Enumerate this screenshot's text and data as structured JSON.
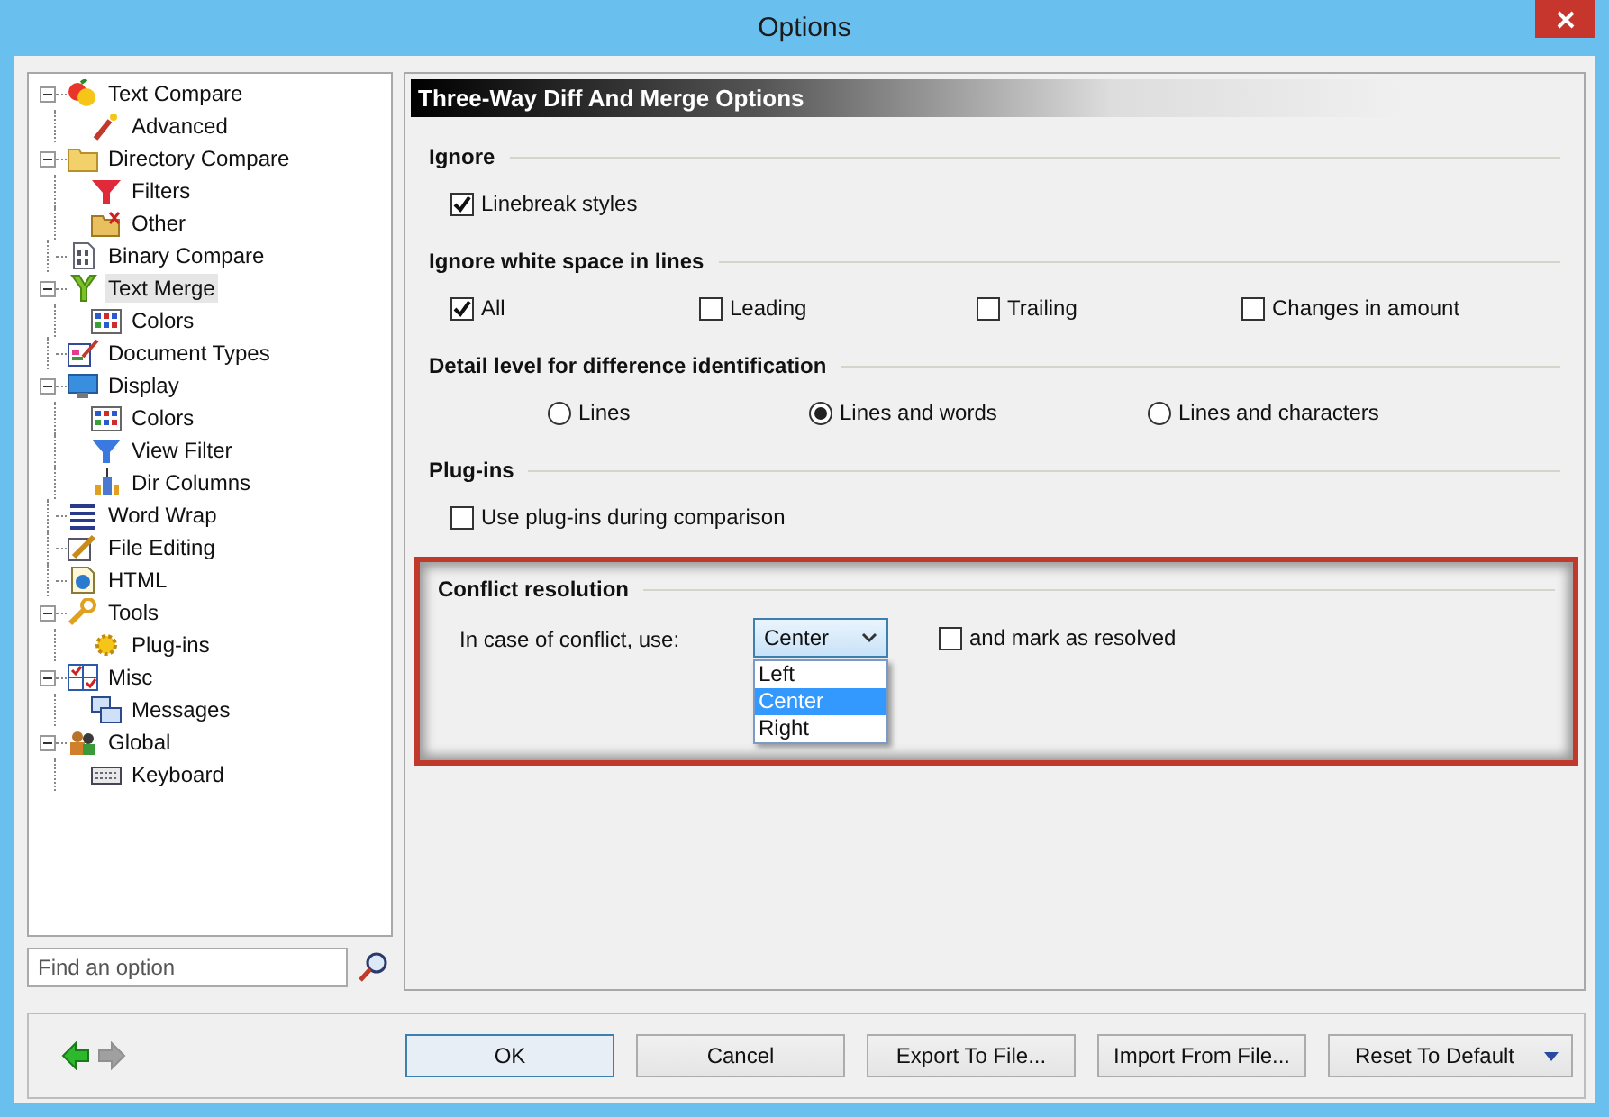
{
  "window": {
    "title": "Options"
  },
  "tree": [
    {
      "label": "Text Compare",
      "expanded": true,
      "selected": false,
      "children": [
        {
          "label": "Advanced",
          "selected": false
        }
      ]
    },
    {
      "label": "Directory Compare",
      "expanded": true,
      "selected": false,
      "children": [
        {
          "label": "Filters",
          "selected": false
        },
        {
          "label": "Other",
          "selected": false
        }
      ]
    },
    {
      "label": "Binary Compare",
      "selected": false
    },
    {
      "label": "Text Merge",
      "expanded": true,
      "selected": true,
      "children": [
        {
          "label": "Colors",
          "selected": false
        }
      ]
    },
    {
      "label": "Document Types",
      "selected": false
    },
    {
      "label": "Display",
      "expanded": true,
      "selected": false,
      "children": [
        {
          "label": "Colors",
          "selected": false
        },
        {
          "label": "View Filter",
          "selected": false
        },
        {
          "label": "Dir Columns",
          "selected": false
        }
      ]
    },
    {
      "label": "Word Wrap",
      "selected": false
    },
    {
      "label": "File Editing",
      "selected": false
    },
    {
      "label": "HTML",
      "selected": false
    },
    {
      "label": "Tools",
      "expanded": true,
      "selected": false,
      "children": [
        {
          "label": "Plug-ins",
          "selected": false
        }
      ]
    },
    {
      "label": "Misc",
      "expanded": true,
      "selected": false,
      "children": [
        {
          "label": "Messages",
          "selected": false
        }
      ]
    },
    {
      "label": "Global",
      "expanded": true,
      "selected": false,
      "children": [
        {
          "label": "Keyboard",
          "selected": false
        }
      ]
    }
  ],
  "search": {
    "placeholder": "Find an option"
  },
  "panel": {
    "title": "Three-Way Diff And Merge Options",
    "groups": [
      {
        "title": "Ignore",
        "options": [
          {
            "kind": "checkbox",
            "label": "Linebreak styles",
            "checked": true
          }
        ]
      },
      {
        "title": "Ignore white space in lines",
        "options": [
          {
            "kind": "checkbox",
            "label": "All",
            "checked": true
          },
          {
            "kind": "checkbox",
            "label": "Leading",
            "checked": false
          },
          {
            "kind": "checkbox",
            "label": "Trailing",
            "checked": false
          },
          {
            "kind": "checkbox",
            "label": "Changes in amount",
            "checked": false
          }
        ]
      },
      {
        "title": "Detail level for difference identification",
        "options": [
          {
            "kind": "radio",
            "label": "Lines",
            "selected": false
          },
          {
            "kind": "radio",
            "label": "Lines and words",
            "selected": true
          },
          {
            "kind": "radio",
            "label": "Lines and characters",
            "selected": false
          }
        ]
      },
      {
        "title": "Plug-ins",
        "options": [
          {
            "kind": "checkbox",
            "label": "Use plug-ins during comparison",
            "checked": false
          }
        ]
      }
    ],
    "conflict": {
      "title": "Conflict resolution",
      "label": "In case of conflict, use:",
      "value": "Center",
      "expanded": true,
      "choices": [
        {
          "label": "Left",
          "selected": false
        },
        {
          "label": "Center",
          "selected": true
        },
        {
          "label": "Right",
          "selected": false
        }
      ],
      "mark_resolved": {
        "label": "and mark as resolved",
        "checked": false
      },
      "highlighted": true
    }
  },
  "history": {
    "back_enabled": true,
    "forward_enabled": false
  },
  "buttons": [
    {
      "label": "OK",
      "default": true,
      "kind": "plain"
    },
    {
      "label": "Cancel",
      "default": false,
      "kind": "plain"
    },
    {
      "label": "Export To File...",
      "default": false,
      "kind": "plain"
    },
    {
      "label": "Import From File...",
      "default": false,
      "kind": "plain"
    },
    {
      "label": "Reset To Default",
      "default": false,
      "kind": "split"
    }
  ]
}
